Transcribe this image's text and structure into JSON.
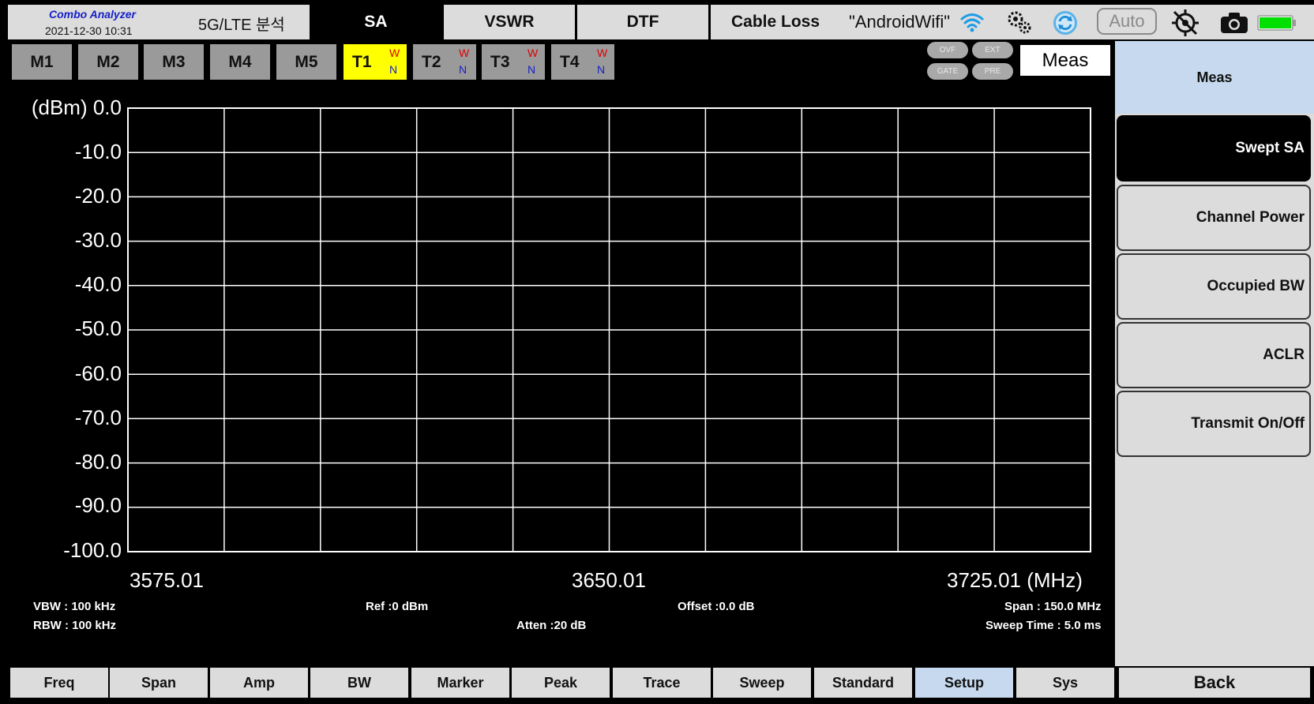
{
  "header": {
    "app_name": "Combo Analyzer",
    "datetime": "2021-12-30 10:31",
    "mode": "5G/LTE 분석",
    "tabs": [
      {
        "label": "SA",
        "active": true
      },
      {
        "label": "VSWR",
        "active": false
      },
      {
        "label": "DTF",
        "active": false
      },
      {
        "label": "Cable Loss",
        "active": false
      }
    ],
    "wifi_name": "\"AndroidWifi\"",
    "auto_label": "Auto",
    "icons": [
      "wifi-icon",
      "settings-gears-icon",
      "sync-icon",
      "gps-icon",
      "camera-icon",
      "battery-icon"
    ],
    "accent_color": "#1520c8",
    "battery_color": "#00e000"
  },
  "markers": [
    "M1",
    "M2",
    "M3",
    "M4",
    "M5"
  ],
  "traces": [
    {
      "label": "T1",
      "w": "W",
      "n": "N",
      "active": true
    },
    {
      "label": "T2",
      "w": "W",
      "n": "N",
      "active": false
    },
    {
      "label": "T3",
      "w": "W",
      "n": "N",
      "active": false
    },
    {
      "label": "T4",
      "w": "W",
      "n": "N",
      "active": false
    }
  ],
  "indicators": {
    "ovf": "OVF",
    "ext": "EXT",
    "gate": "GATE",
    "pre": "PRE"
  },
  "meas_title": "Meas",
  "plot": {
    "y_unit": "(dBm)",
    "y_ticks": [
      "0.0",
      "-10.0",
      "-20.0",
      "-30.0",
      "-40.0",
      "-50.0",
      "-60.0",
      "-70.0",
      "-80.0",
      "-90.0",
      "-100.0"
    ],
    "x_start": "3575.01",
    "x_center": "3650.01",
    "x_stop": "3725.01 (MHz)",
    "grid_color": "#ffffff"
  },
  "info": {
    "vbw": "VBW : 100 kHz",
    "rbw": "RBW : 100 kHz",
    "ref": "Ref :0 dBm",
    "atten": "Atten :20 dB",
    "offset": "Offset :0.0 dB",
    "span": "Span : 150.0 MHz",
    "sweep_time": "Sweep Time : 5.0 ms"
  },
  "panel": {
    "title": "Meas",
    "items": [
      {
        "label": "Swept SA",
        "active": true
      },
      {
        "label": "Channel Power",
        "active": false
      },
      {
        "label": "Occupied BW",
        "active": false
      },
      {
        "label": "ACLR",
        "active": false
      },
      {
        "label": "Transmit On/Off",
        "active": false
      }
    ]
  },
  "bottom": {
    "items": [
      {
        "label": "Freq",
        "active": false
      },
      {
        "label": "Span",
        "active": false
      },
      {
        "label": "Amp",
        "active": false
      },
      {
        "label": "BW",
        "active": false
      },
      {
        "label": "Marker",
        "active": false
      },
      {
        "label": "Peak",
        "active": false
      },
      {
        "label": "Trace",
        "active": false
      },
      {
        "label": "Sweep",
        "active": false
      },
      {
        "label": "Standard",
        "active": false
      },
      {
        "label": "Setup",
        "active": true
      },
      {
        "label": "Sys",
        "active": false
      }
    ],
    "back_label": "Back"
  }
}
